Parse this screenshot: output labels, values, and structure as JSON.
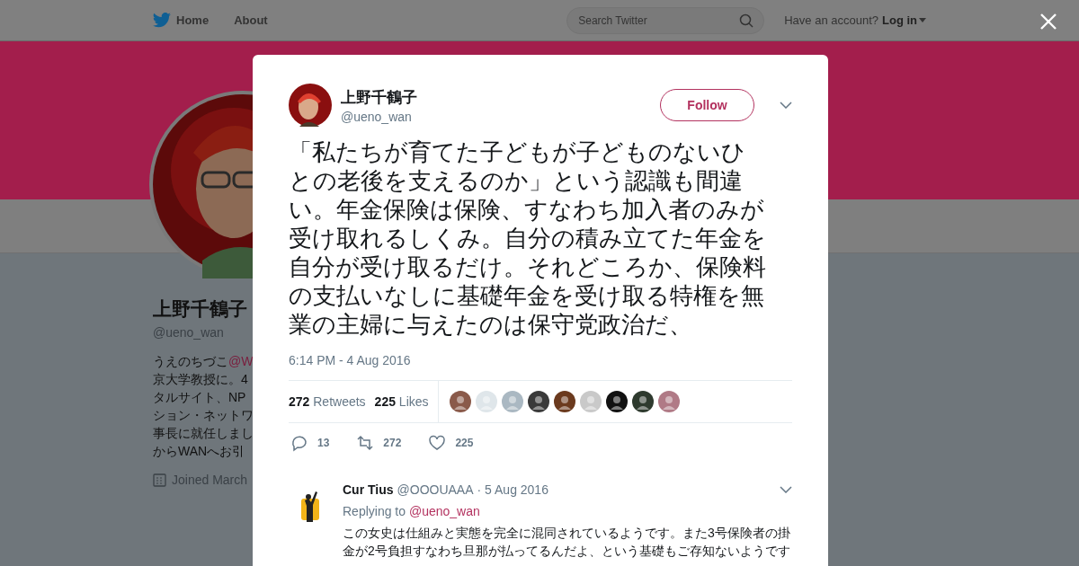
{
  "nav": {
    "home": "Home",
    "about": "About",
    "search_placeholder": "Search Twitter",
    "account_prompt": "Have an account?",
    "login": "Log in"
  },
  "profile": {
    "name": "上野千鶴子",
    "handle": "@ueno_wan",
    "bio_first": "うえのちづこ",
    "bio_link": "@W",
    "bio_lines": [
      "京大学教授に。4",
      "タルサイト、NP",
      "ション・ネットワ",
      "事長に就任しまし",
      "からWANへお引"
    ],
    "joined": "Joined March"
  },
  "tweet": {
    "name": "上野千鶴子",
    "handle": "@ueno_wan",
    "follow": "Follow",
    "text_lines": [
      "「私たちが育てた子どもが子どものないひ",
      "との老後を支えるのか」という認識も間違",
      "い。年金保険は保険、すなわち加入者のみが",
      "受け取れるしくみ。自分の積み立てた年金を",
      "自分が受け取るだけ。それどころか、保険料",
      "の支払いなしに基礎年金を受け取る特権を無",
      "業の主婦に与えたのは保守党政治だ、"
    ],
    "timestamp": "6:14 PM - 4 Aug 2016",
    "stats": [
      {
        "count": "272",
        "label": "Retweets"
      },
      {
        "count": "225",
        "label": "Likes"
      }
    ],
    "likers": [
      {
        "color": "#8a5a4a"
      },
      {
        "color": "#dfe6ea"
      },
      {
        "color": "#aab8c2"
      },
      {
        "color": "#3a3a3a"
      },
      {
        "color": "#6b3a1e"
      },
      {
        "color": "#c9c9c9"
      },
      {
        "color": "#111111"
      },
      {
        "color": "#2e3a2e"
      },
      {
        "color": "#b07a86"
      }
    ],
    "actions": [
      {
        "kind": "reply",
        "count": "13"
      },
      {
        "kind": "retweet",
        "count": "272"
      },
      {
        "kind": "like",
        "count": "225"
      }
    ]
  },
  "reply": {
    "name": "Cur Tius",
    "handle": "@OOOUAAA",
    "date": "· 5 Aug 2016",
    "replying_to": "Replying to",
    "reply_handle": "@ueno_wan",
    "text": "この女史は仕組みと実態を完全に混同されているようです。また3号保険者の掛金が2号負担すなわち旦那が払ってるんだよ、という基礎もご存知ないようです"
  }
}
